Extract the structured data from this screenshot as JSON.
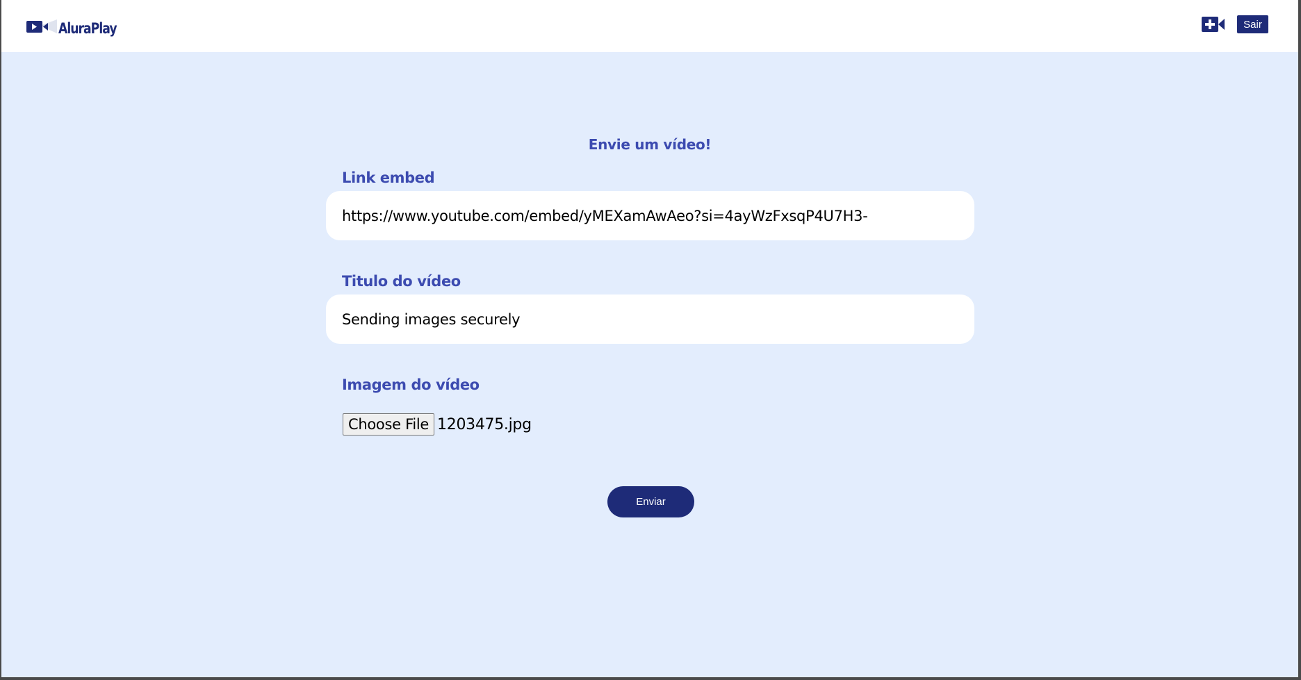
{
  "header": {
    "logo_text": "AluraPlay",
    "add_video_icon": "video-camera-plus-icon",
    "logout_label": "Sair"
  },
  "form": {
    "title": "Envie um vídeo!",
    "embed": {
      "label": "Link embed",
      "value": "https://www.youtube.com/embed/yMEXamAwAeo?si=4ayWzFxsqP4U7H3-"
    },
    "video_title": {
      "label": "Titulo do vídeo",
      "value": "Sending images securely"
    },
    "image": {
      "label": "Imagem do vídeo",
      "button_label": "Choose File",
      "file_name": "1203475.jpg"
    },
    "submit_label": "Enviar"
  },
  "colors": {
    "brand": "#1e2b78",
    "label": "#3c4bb0",
    "background": "#e3edfd"
  }
}
